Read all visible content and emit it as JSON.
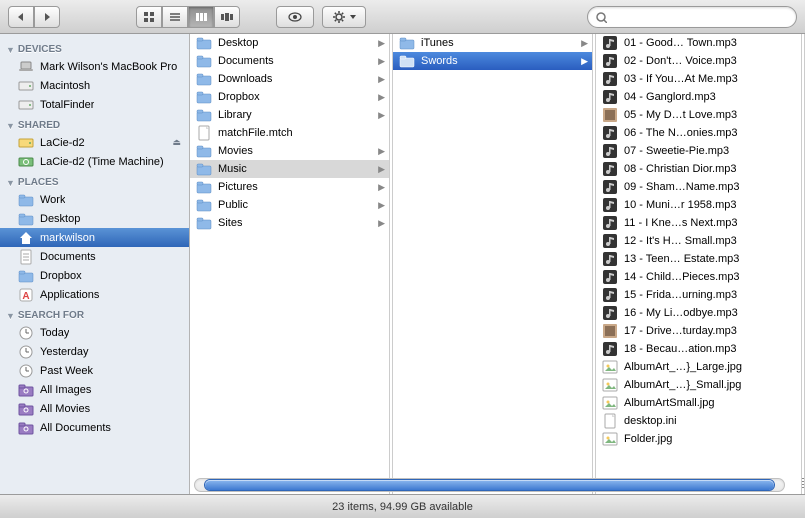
{
  "toolbar": {
    "search_placeholder": ""
  },
  "sidebar": {
    "sections": [
      {
        "title": "DEVICES",
        "items": [
          {
            "label": "Mark Wilson's MacBook Pro",
            "icon": "laptop"
          },
          {
            "label": "Macintosh",
            "icon": "hdd"
          },
          {
            "label": "TotalFinder",
            "icon": "hdd"
          }
        ]
      },
      {
        "title": "SHARED",
        "items": [
          {
            "label": "LaCie-d2",
            "icon": "ext-drive",
            "eject": true
          },
          {
            "label": "LaCie-d2 (Time Machine)",
            "icon": "tm-drive"
          }
        ]
      },
      {
        "title": "PLACES",
        "items": [
          {
            "label": "Work",
            "icon": "folder"
          },
          {
            "label": "Desktop",
            "icon": "folder"
          },
          {
            "label": "markwilson",
            "icon": "home",
            "selected": true
          },
          {
            "label": "Documents",
            "icon": "doc"
          },
          {
            "label": "Dropbox",
            "icon": "folder"
          },
          {
            "label": "Applications",
            "icon": "apps"
          }
        ]
      },
      {
        "title": "SEARCH FOR",
        "items": [
          {
            "label": "Today",
            "icon": "clock"
          },
          {
            "label": "Yesterday",
            "icon": "clock"
          },
          {
            "label": "Past Week",
            "icon": "clock"
          },
          {
            "label": "All Images",
            "icon": "smart"
          },
          {
            "label": "All Movies",
            "icon": "smart"
          },
          {
            "label": "All Documents",
            "icon": "smart"
          }
        ]
      }
    ]
  },
  "column1": [
    {
      "label": "Desktop",
      "icon": "folder",
      "expandable": true
    },
    {
      "label": "Documents",
      "icon": "folder",
      "expandable": true
    },
    {
      "label": "Downloads",
      "icon": "folder",
      "expandable": true
    },
    {
      "label": "Dropbox",
      "icon": "folder",
      "expandable": true
    },
    {
      "label": "Library",
      "icon": "folder",
      "expandable": true
    },
    {
      "label": "matchFile.mtch",
      "icon": "file",
      "expandable": false
    },
    {
      "label": "Movies",
      "icon": "folder",
      "expandable": true
    },
    {
      "label": "Music",
      "icon": "folder",
      "expandable": true,
      "selected": true
    },
    {
      "label": "Pictures",
      "icon": "folder",
      "expandable": true
    },
    {
      "label": "Public",
      "icon": "folder",
      "expandable": true
    },
    {
      "label": "Sites",
      "icon": "folder",
      "expandable": true
    }
  ],
  "column2": [
    {
      "label": "iTunes",
      "icon": "folder",
      "expandable": true
    },
    {
      "label": "Swords",
      "icon": "folder",
      "expandable": true,
      "selected": true
    }
  ],
  "column3": [
    {
      "label": "01 - Good… Town.mp3",
      "icon": "audio"
    },
    {
      "label": "02 - Don't… Voice.mp3",
      "icon": "audio"
    },
    {
      "label": "03 - If You…At Me.mp3",
      "icon": "audio"
    },
    {
      "label": "04 - Ganglord.mp3",
      "icon": "audio"
    },
    {
      "label": "05 - My D…t Love.mp3",
      "icon": "cover"
    },
    {
      "label": "06 - The N…onies.mp3",
      "icon": "audio"
    },
    {
      "label": "07 - Sweetie-Pie.mp3",
      "icon": "audio"
    },
    {
      "label": "08 - Christian Dior.mp3",
      "icon": "audio"
    },
    {
      "label": "09 - Sham…Name.mp3",
      "icon": "audio"
    },
    {
      "label": "10 - Muni…r 1958.mp3",
      "icon": "audio"
    },
    {
      "label": "11 - I Kne…s Next.mp3",
      "icon": "audio"
    },
    {
      "label": "12 - It's H… Small.mp3",
      "icon": "audio"
    },
    {
      "label": "13 - Teen… Estate.mp3",
      "icon": "audio"
    },
    {
      "label": "14 - Child…Pieces.mp3",
      "icon": "audio"
    },
    {
      "label": "15 - Frida…urning.mp3",
      "icon": "audio"
    },
    {
      "label": "16 - My Li…odbye.mp3",
      "icon": "audio"
    },
    {
      "label": "17 - Drive…turday.mp3",
      "icon": "cover"
    },
    {
      "label": "18 - Becau…ation.mp3",
      "icon": "audio"
    },
    {
      "label": "AlbumArt_…}_Large.jpg",
      "icon": "image"
    },
    {
      "label": "AlbumArt_…}_Small.jpg",
      "icon": "image"
    },
    {
      "label": "AlbumArtSmall.jpg",
      "icon": "image"
    },
    {
      "label": "desktop.ini",
      "icon": "file"
    },
    {
      "label": "Folder.jpg",
      "icon": "image"
    }
  ],
  "status": "23 items, 94.99 GB available"
}
